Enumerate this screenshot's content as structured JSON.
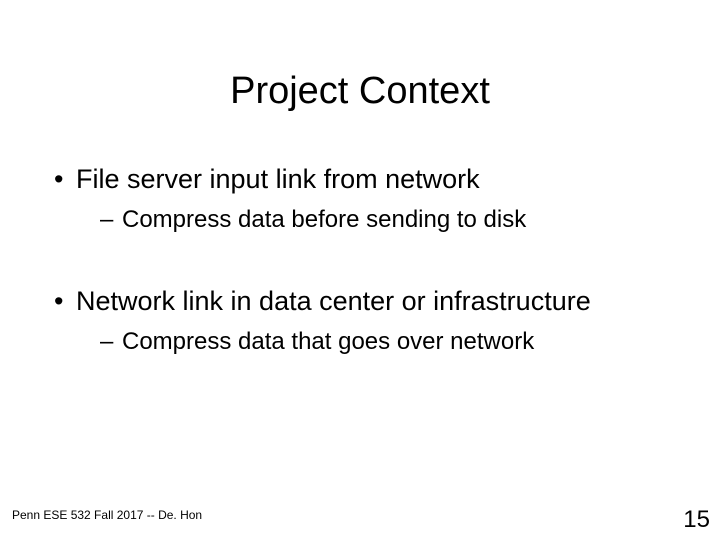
{
  "slide": {
    "title": "Project Context",
    "bullets": [
      {
        "level": 1,
        "text": "File server input link from network"
      },
      {
        "level": 2,
        "text": "Compress data before sending to disk"
      },
      {
        "level": 1,
        "text": "Network link in data center or infrastructure"
      },
      {
        "level": 2,
        "text": "Compress data that goes over network"
      }
    ],
    "footer": "Penn ESE 532 Fall 2017 -- De. Hon",
    "page_number": "15"
  }
}
